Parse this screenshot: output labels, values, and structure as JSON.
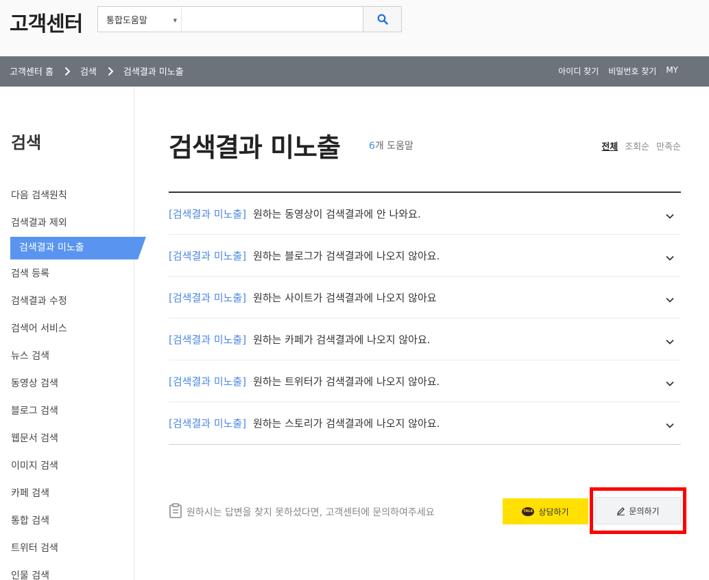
{
  "header": {
    "logo": "고객센터",
    "search": {
      "scope": "통합도움말",
      "value": "",
      "placeholder": ""
    }
  },
  "navbar": {
    "breadcrumbs": [
      "고객센터 홈",
      "검색",
      "검색결과 미노출"
    ],
    "links": [
      "아이디 찾기",
      "비밀번호 찾기",
      "MY"
    ]
  },
  "sidebar": {
    "title": "검색",
    "items": [
      {
        "label": "다음 검색원칙",
        "active": false
      },
      {
        "label": "검색결과 제외",
        "active": false
      },
      {
        "label": "검색결과 미노출",
        "active": true
      },
      {
        "label": "검색 등록",
        "active": false
      },
      {
        "label": "검색결과 수정",
        "active": false
      },
      {
        "label": "검색어 서비스",
        "active": false
      },
      {
        "label": "뉴스 검색",
        "active": false
      },
      {
        "label": "동영상 검색",
        "active": false
      },
      {
        "label": "블로그 검색",
        "active": false
      },
      {
        "label": "웹문서 검색",
        "active": false
      },
      {
        "label": "이미지 검색",
        "active": false
      },
      {
        "label": "카페 검색",
        "active": false
      },
      {
        "label": "통합 검색",
        "active": false
      },
      {
        "label": "트위터 검색",
        "active": false
      },
      {
        "label": "인물 검색",
        "active": false
      }
    ]
  },
  "main": {
    "title": "검색결과 미노출",
    "count_num": "6",
    "count_label": "개 도움말",
    "sort": [
      "전체",
      "조회순",
      "만족순"
    ],
    "faq": [
      {
        "tag": "[검색결과 미노출]",
        "question": "원하는 동영상이 검색결과에 안 나와요."
      },
      {
        "tag": "[검색결과 미노출]",
        "question": "원하는 블로그가 검색결과에 나오지 않아요."
      },
      {
        "tag": "[검색결과 미노출]",
        "question": "원하는 사이트가 검색결과에 나오지 않아요"
      },
      {
        "tag": "[검색결과 미노출]",
        "question": "원하는 카페가 검색결과에 나오지 않아요."
      },
      {
        "tag": "[검색결과 미노출]",
        "question": "원하는 트위터가 검색결과에 나오지 않아요."
      },
      {
        "tag": "[검색결과 미노출]",
        "question": "원하는 스토리가 검색결과에 나오지 않아요."
      }
    ],
    "help_text": "원하시는 답변을 찾지 못하셨다면, 고객센터에 문의하여주세요",
    "talk_button": "상담하기",
    "talk_icon_text": "TALK",
    "ask_button": "문의하기"
  },
  "colors": {
    "accent": "#5995f0",
    "link": "#4a86e8",
    "navbar": "#6c737b",
    "highlight": "#ff0000",
    "talk": "#ffe000"
  }
}
